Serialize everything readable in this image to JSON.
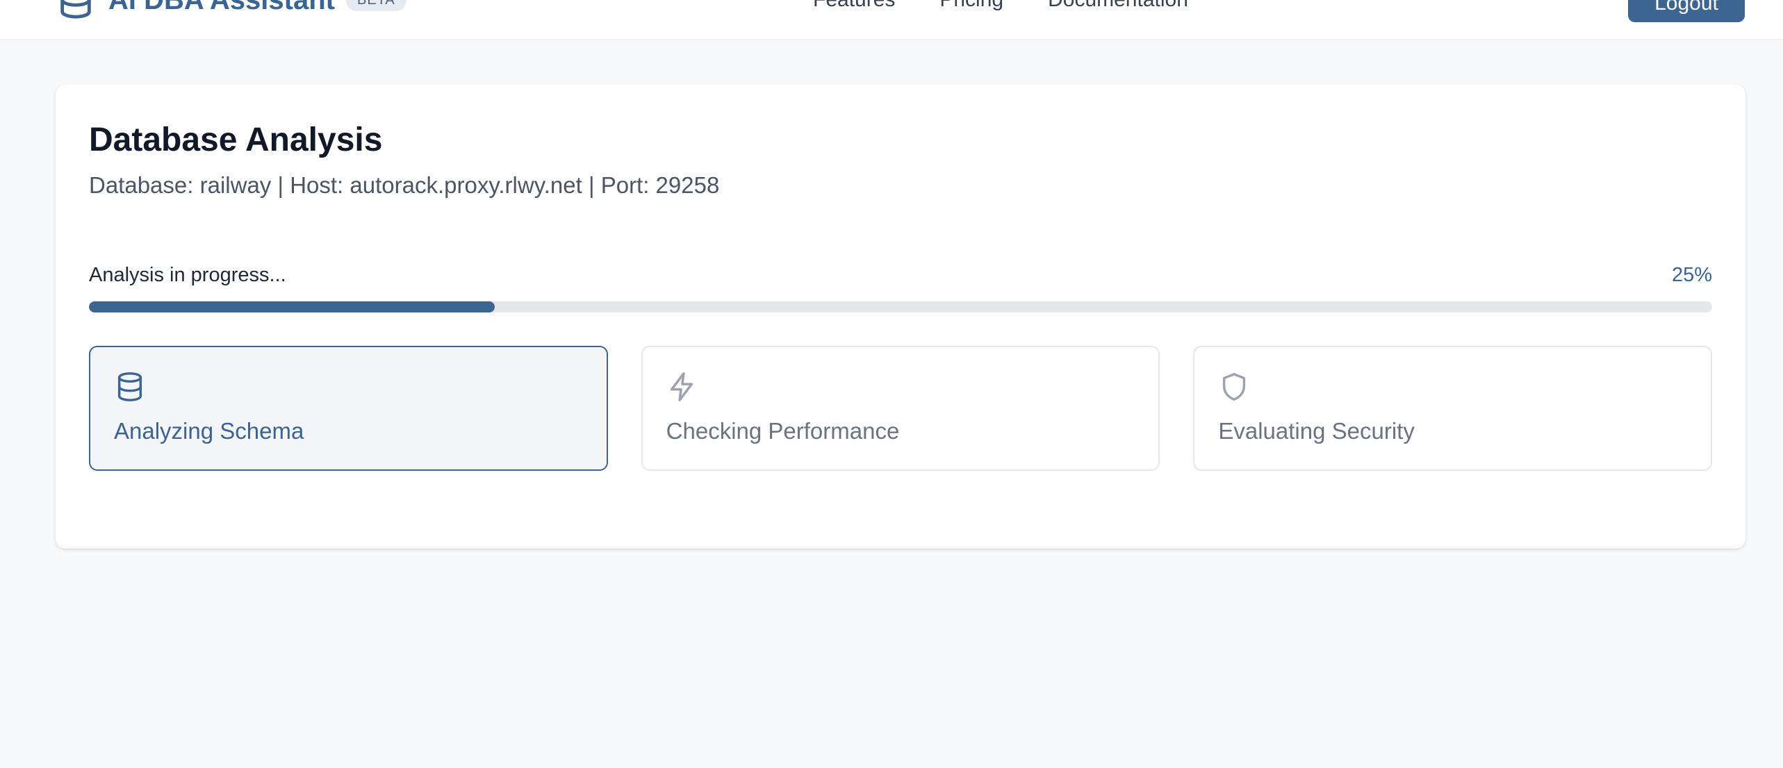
{
  "header": {
    "app_name": "AI DBA Assistant",
    "badge": "BETA",
    "nav": [
      {
        "label": "Features"
      },
      {
        "label": "Pricing"
      },
      {
        "label": "Documentation"
      }
    ],
    "logout_label": "Logout"
  },
  "analysis": {
    "title": "Database Analysis",
    "connection_info": "Database: railway | Host: autorack.proxy.rlwy.net | Port: 29258",
    "progress": {
      "label": "Analysis in progress...",
      "percent_text": "25%",
      "value": 0.25
    },
    "steps": [
      {
        "label": "Analyzing Schema",
        "icon": "database-icon",
        "state": "active"
      },
      {
        "label": "Checking Performance",
        "icon": "lightning-icon",
        "state": "pending"
      },
      {
        "label": "Evaluating Security",
        "icon": "shield-icon",
        "state": "pending"
      }
    ]
  },
  "colors": {
    "accent": "#3d6591",
    "page_background": "#f8f9fb",
    "track": "#e5e7eb",
    "muted_text": "#6b7280"
  }
}
